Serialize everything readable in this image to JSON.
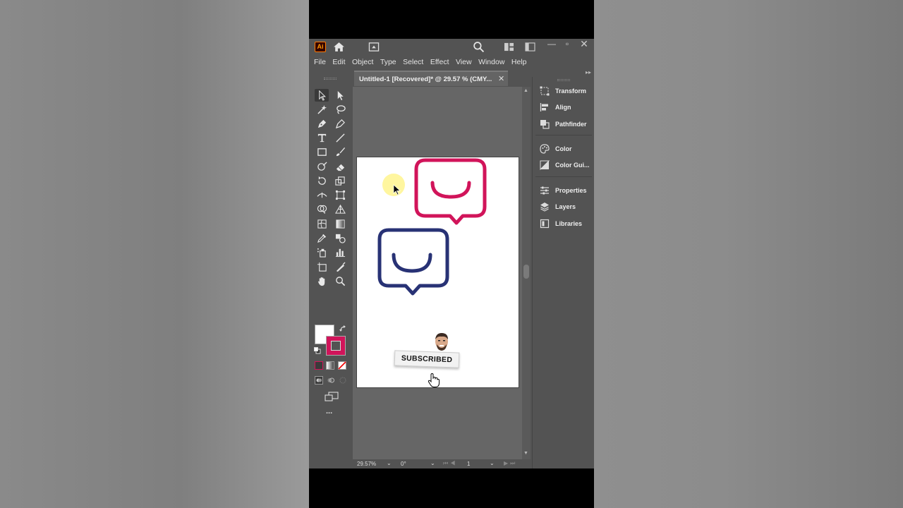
{
  "app": {
    "logo": "Ai",
    "menu": [
      "File",
      "Edit",
      "Object",
      "Type",
      "Select",
      "Effect",
      "View",
      "Window",
      "Help"
    ]
  },
  "document": {
    "tab_title": "Untitled-1 [Recovered]* @ 29.57 % (CMY..."
  },
  "status": {
    "zoom": "29.57%",
    "rotation": "0°",
    "page": "1"
  },
  "right_panel": {
    "group1": [
      "Transform",
      "Align",
      "Pathfinder"
    ],
    "group2": [
      "Color",
      "Color Gui..."
    ],
    "group3": [
      "Properties",
      "Layers",
      "Libraries"
    ]
  },
  "artwork": {
    "pink_color": "#d1145a",
    "navy_color": "#283275"
  },
  "overlay": {
    "subscribe_label": "SUBSCRIBED"
  },
  "tools": {
    "more": "..."
  }
}
